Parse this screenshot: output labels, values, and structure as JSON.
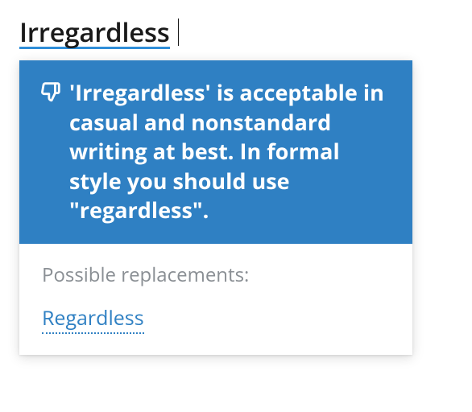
{
  "editor": {
    "flagged_word": "Irregardless"
  },
  "card": {
    "icon": "thumbs-down-icon",
    "explanation": "'Irregardless' is acceptable in casual and nonstandard writing at best. In formal style you should use \"regardless\".",
    "replacements_label": "Possible replacements:",
    "replacements": [
      "Regardless"
    ]
  },
  "colors": {
    "accent": "#2f80c3",
    "underline": "#2f8ed8"
  }
}
